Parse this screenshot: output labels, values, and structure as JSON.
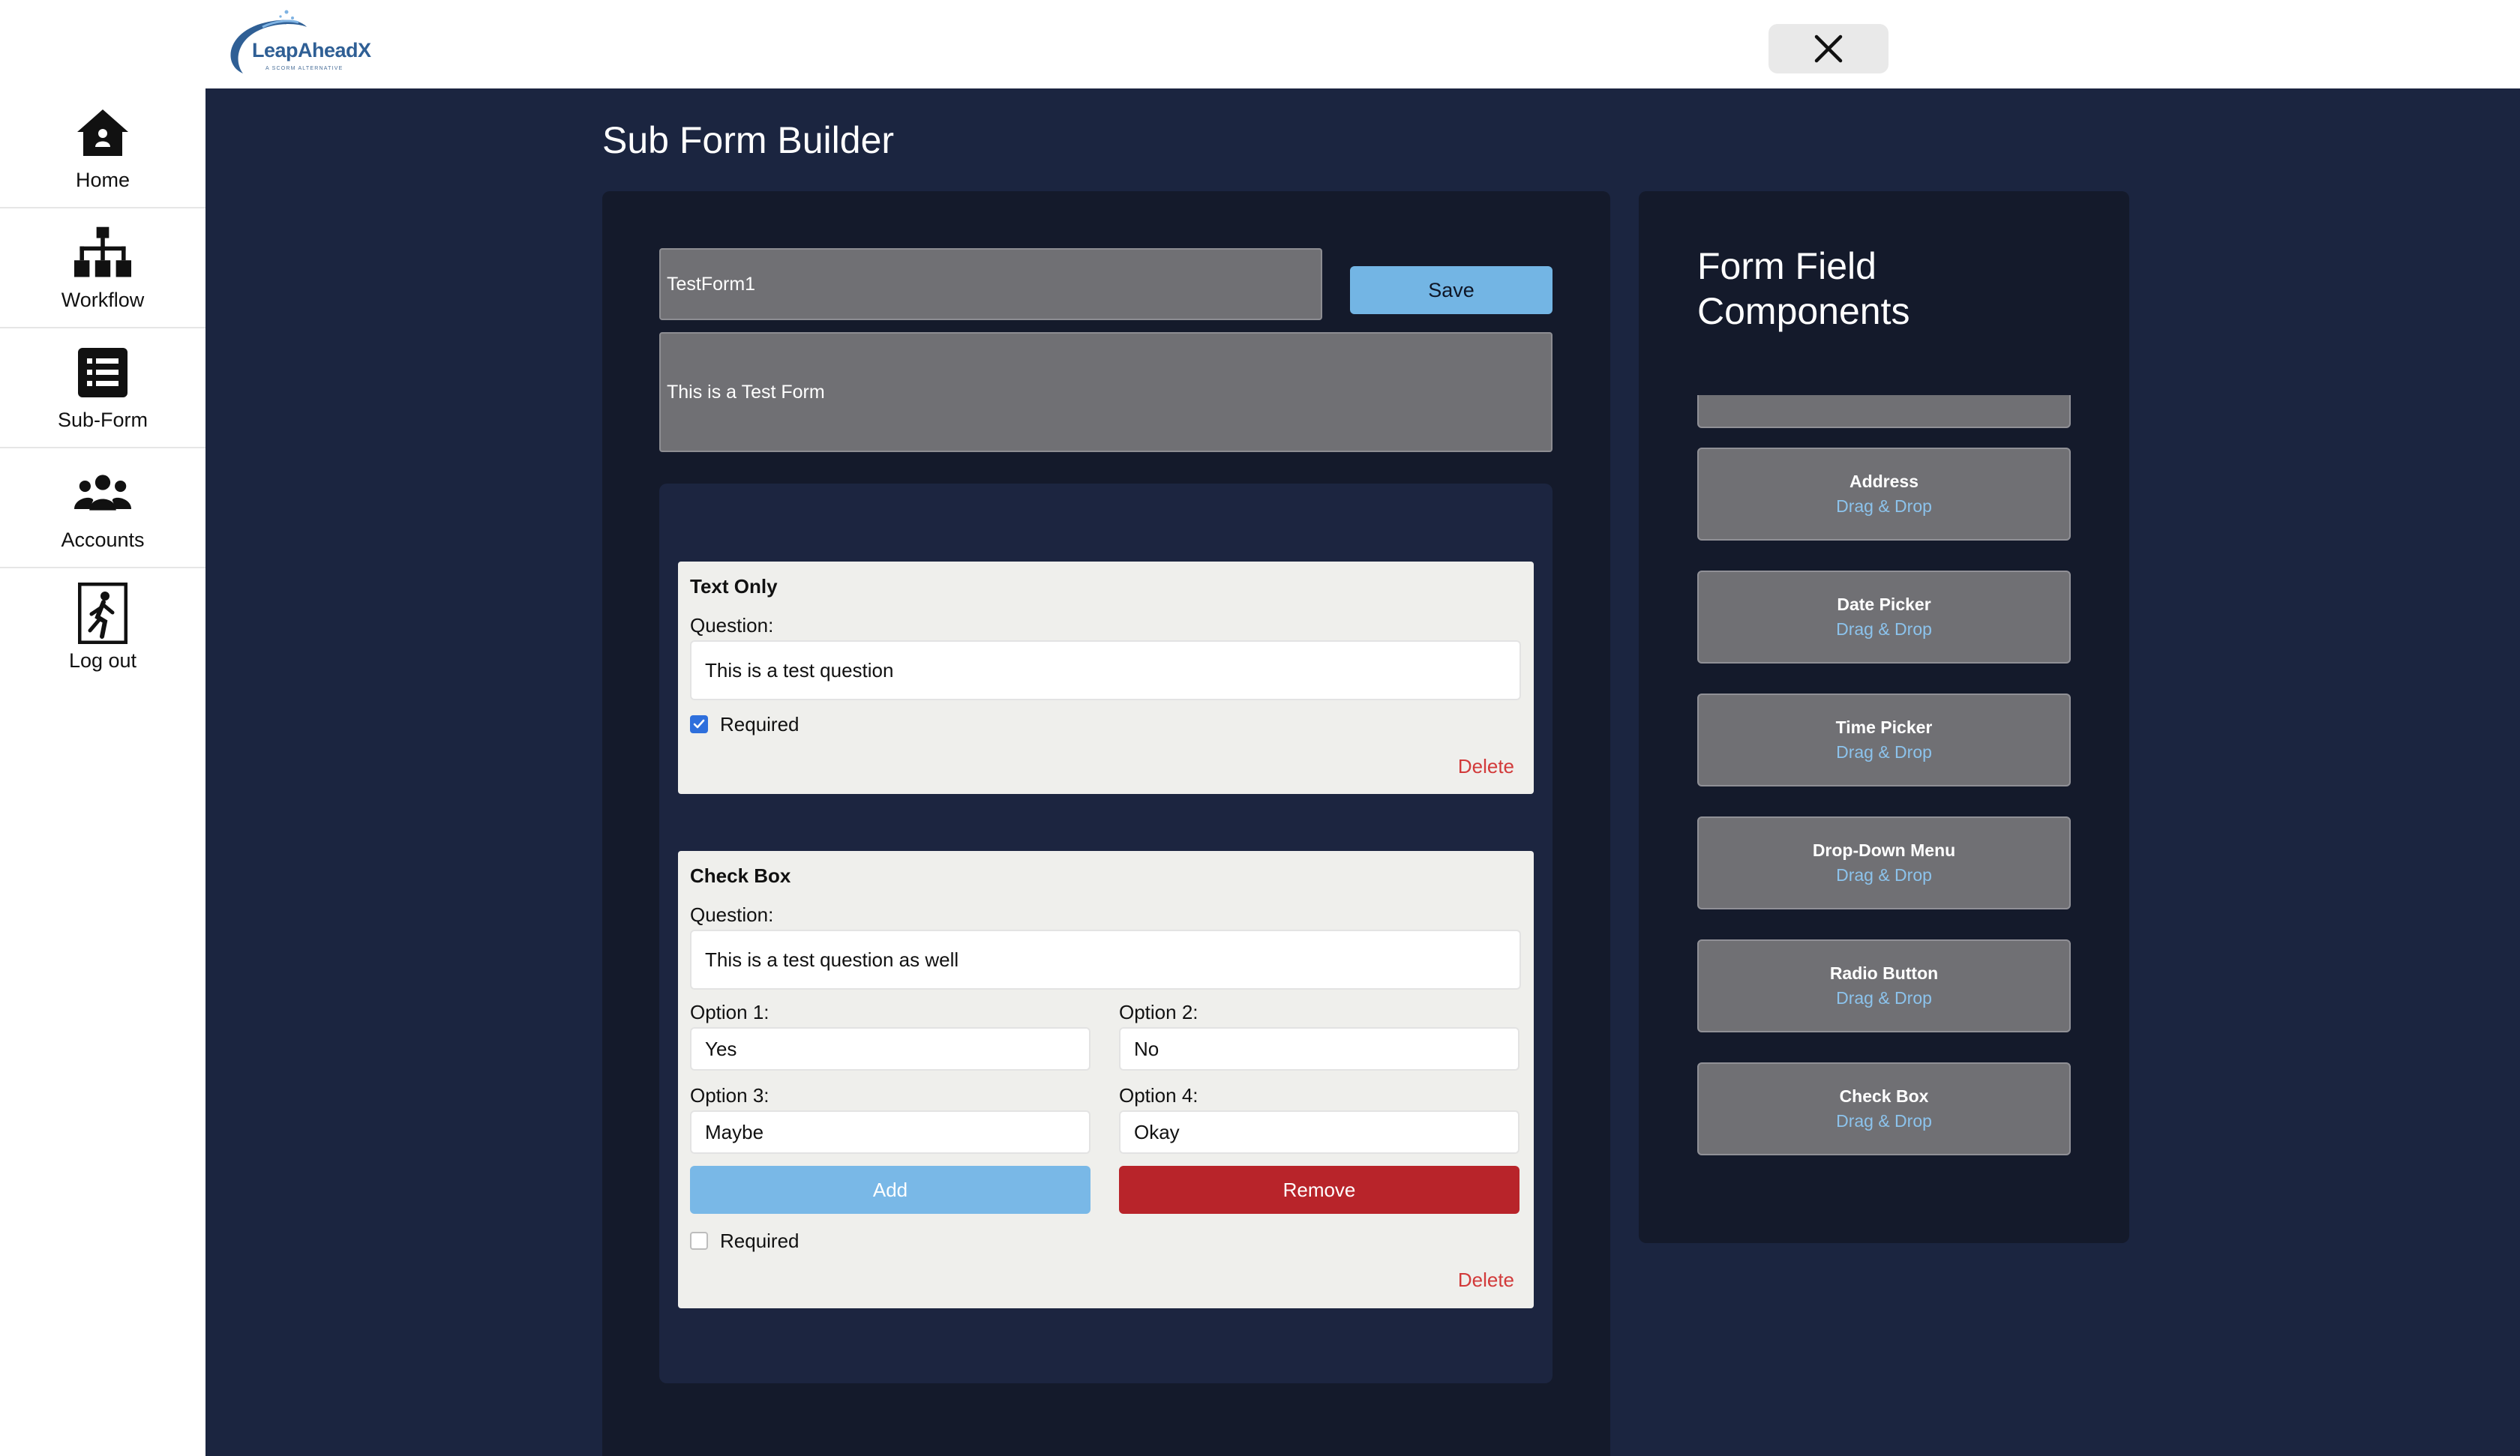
{
  "header": {
    "logo_text": "LeapAheadX",
    "logo_tagline": "A SCORM ALTERNATIVE",
    "close_icon": "close-icon"
  },
  "sidebar": {
    "items": [
      {
        "label": "Home",
        "icon": "home-icon"
      },
      {
        "label": "Workflow",
        "icon": "workflow-icon"
      },
      {
        "label": "Sub-Form",
        "icon": "list-icon"
      },
      {
        "label": "Accounts",
        "icon": "users-icon"
      },
      {
        "label": "Log out",
        "icon": "logout-icon"
      }
    ]
  },
  "page": {
    "title": "Sub Form Builder"
  },
  "form": {
    "name": "TestForm1",
    "description": "This is a Test Form",
    "save_label": "Save"
  },
  "fields": [
    {
      "type_label": "Text Only",
      "question_label": "Question:",
      "question_value": "This is a test question",
      "required_label": "Required",
      "required": true,
      "delete_label": "Delete"
    },
    {
      "type_label": "Check Box",
      "question_label": "Question:",
      "question_value": "This is a test question as well",
      "options": [
        {
          "label": "Option 1:",
          "value": "Yes"
        },
        {
          "label": "Option 2:",
          "value": "No"
        },
        {
          "label": "Option 3:",
          "value": "Maybe"
        },
        {
          "label": "Option 4:",
          "value": "Okay"
        }
      ],
      "add_label": "Add",
      "remove_label": "Remove",
      "required_label": "Required",
      "required": false,
      "delete_label": "Delete"
    }
  ],
  "components": {
    "title": "Form Field Components",
    "drag_hint": "Drag & Drop",
    "items": [
      {
        "name": "Address"
      },
      {
        "name": "Date Picker"
      },
      {
        "name": "Time Picker"
      },
      {
        "name": "Drop-Down Menu"
      },
      {
        "name": "Radio Button"
      },
      {
        "name": "Check Box"
      }
    ]
  },
  "colors": {
    "main_bg": "#1b2540",
    "panel_bg": "#141a2b",
    "save_button": "#73b5e4",
    "add_button": "#79b8e7",
    "remove_button": "#b8242a",
    "delete_text": "#d23a3a",
    "drag_hint": "#8cc3ec",
    "logo": "#2f5f95"
  }
}
